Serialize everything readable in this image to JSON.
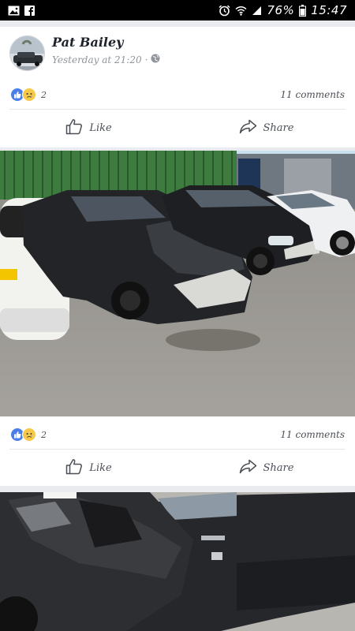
{
  "status_bar": {
    "battery": "76%",
    "time": "15:47",
    "left_icons": [
      "image-icon",
      "facebook-icon"
    ],
    "right_icons": [
      "alarm-icon",
      "wifi-icon",
      "signal-icon",
      "battery-icon"
    ]
  },
  "post": {
    "author": "Pat Bailey",
    "timestamp": "Yesterday at 21:20",
    "separator": "·",
    "privacy_icon": "globe-icon"
  },
  "stats": [
    {
      "reaction_count": "2",
      "comments": "11 comments"
    },
    {
      "reaction_count": "2",
      "comments": "11 comments"
    }
  ],
  "actions": {
    "like": "Like",
    "share": "Share"
  },
  "colors": {
    "like_blue": "#4a7ee8",
    "sad_yellow": "#f7c948",
    "background": "#e9ebee"
  }
}
